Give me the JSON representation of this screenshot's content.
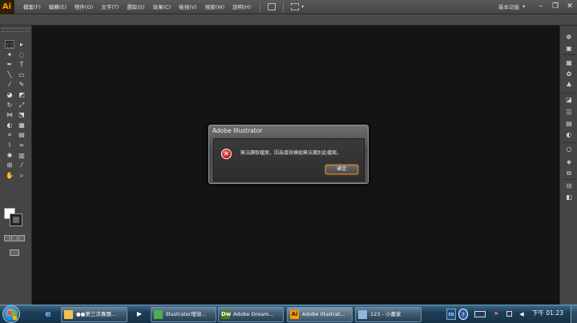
{
  "app": {
    "logo": "Ai"
  },
  "menus": [
    "檔案(F)",
    "編輯(E)",
    "物件(O)",
    "文字(T)",
    "選取(S)",
    "效果(C)",
    "檢視(V)",
    "視窗(W)",
    "說明(H)"
  ],
  "workspace": {
    "label": "基本功能",
    "chevron": "▾"
  },
  "window_controls": {
    "minimize": "–",
    "restore": "❐",
    "close": "✕"
  },
  "dialog": {
    "title": "Adobe Illustrator",
    "message": "無法讀取檔案，因為增效模組無法識別此檔案。",
    "ok_label": "確定",
    "error_glyph": "✕"
  },
  "taskbar": {
    "buttons": [
      {
        "label": "●●第三次專題...",
        "icon": "folder-icon",
        "color": "#f2c14e"
      },
      {
        "label": "Illustrator增效...",
        "icon": "chrome-icon",
        "color": "#4caf50"
      },
      {
        "label": "Adobe Dream...",
        "icon": "dreamweaver-icon",
        "glyph": "Dw",
        "color": "#4f7a1a"
      },
      {
        "label": "Adobe Illustrat...",
        "icon": "illustrator-icon",
        "glyph": "Ai",
        "color": "#ff9a00"
      },
      {
        "label": "123 - 小畫家",
        "icon": "paint-icon",
        "color": "#8fb7e0"
      }
    ],
    "quick": {
      "ie": "e",
      "media": "▶"
    },
    "tray": {
      "lang": "EN",
      "help": "?",
      "flag": "⚑",
      "speaker": "◀"
    },
    "clock": "下午 01:23"
  }
}
